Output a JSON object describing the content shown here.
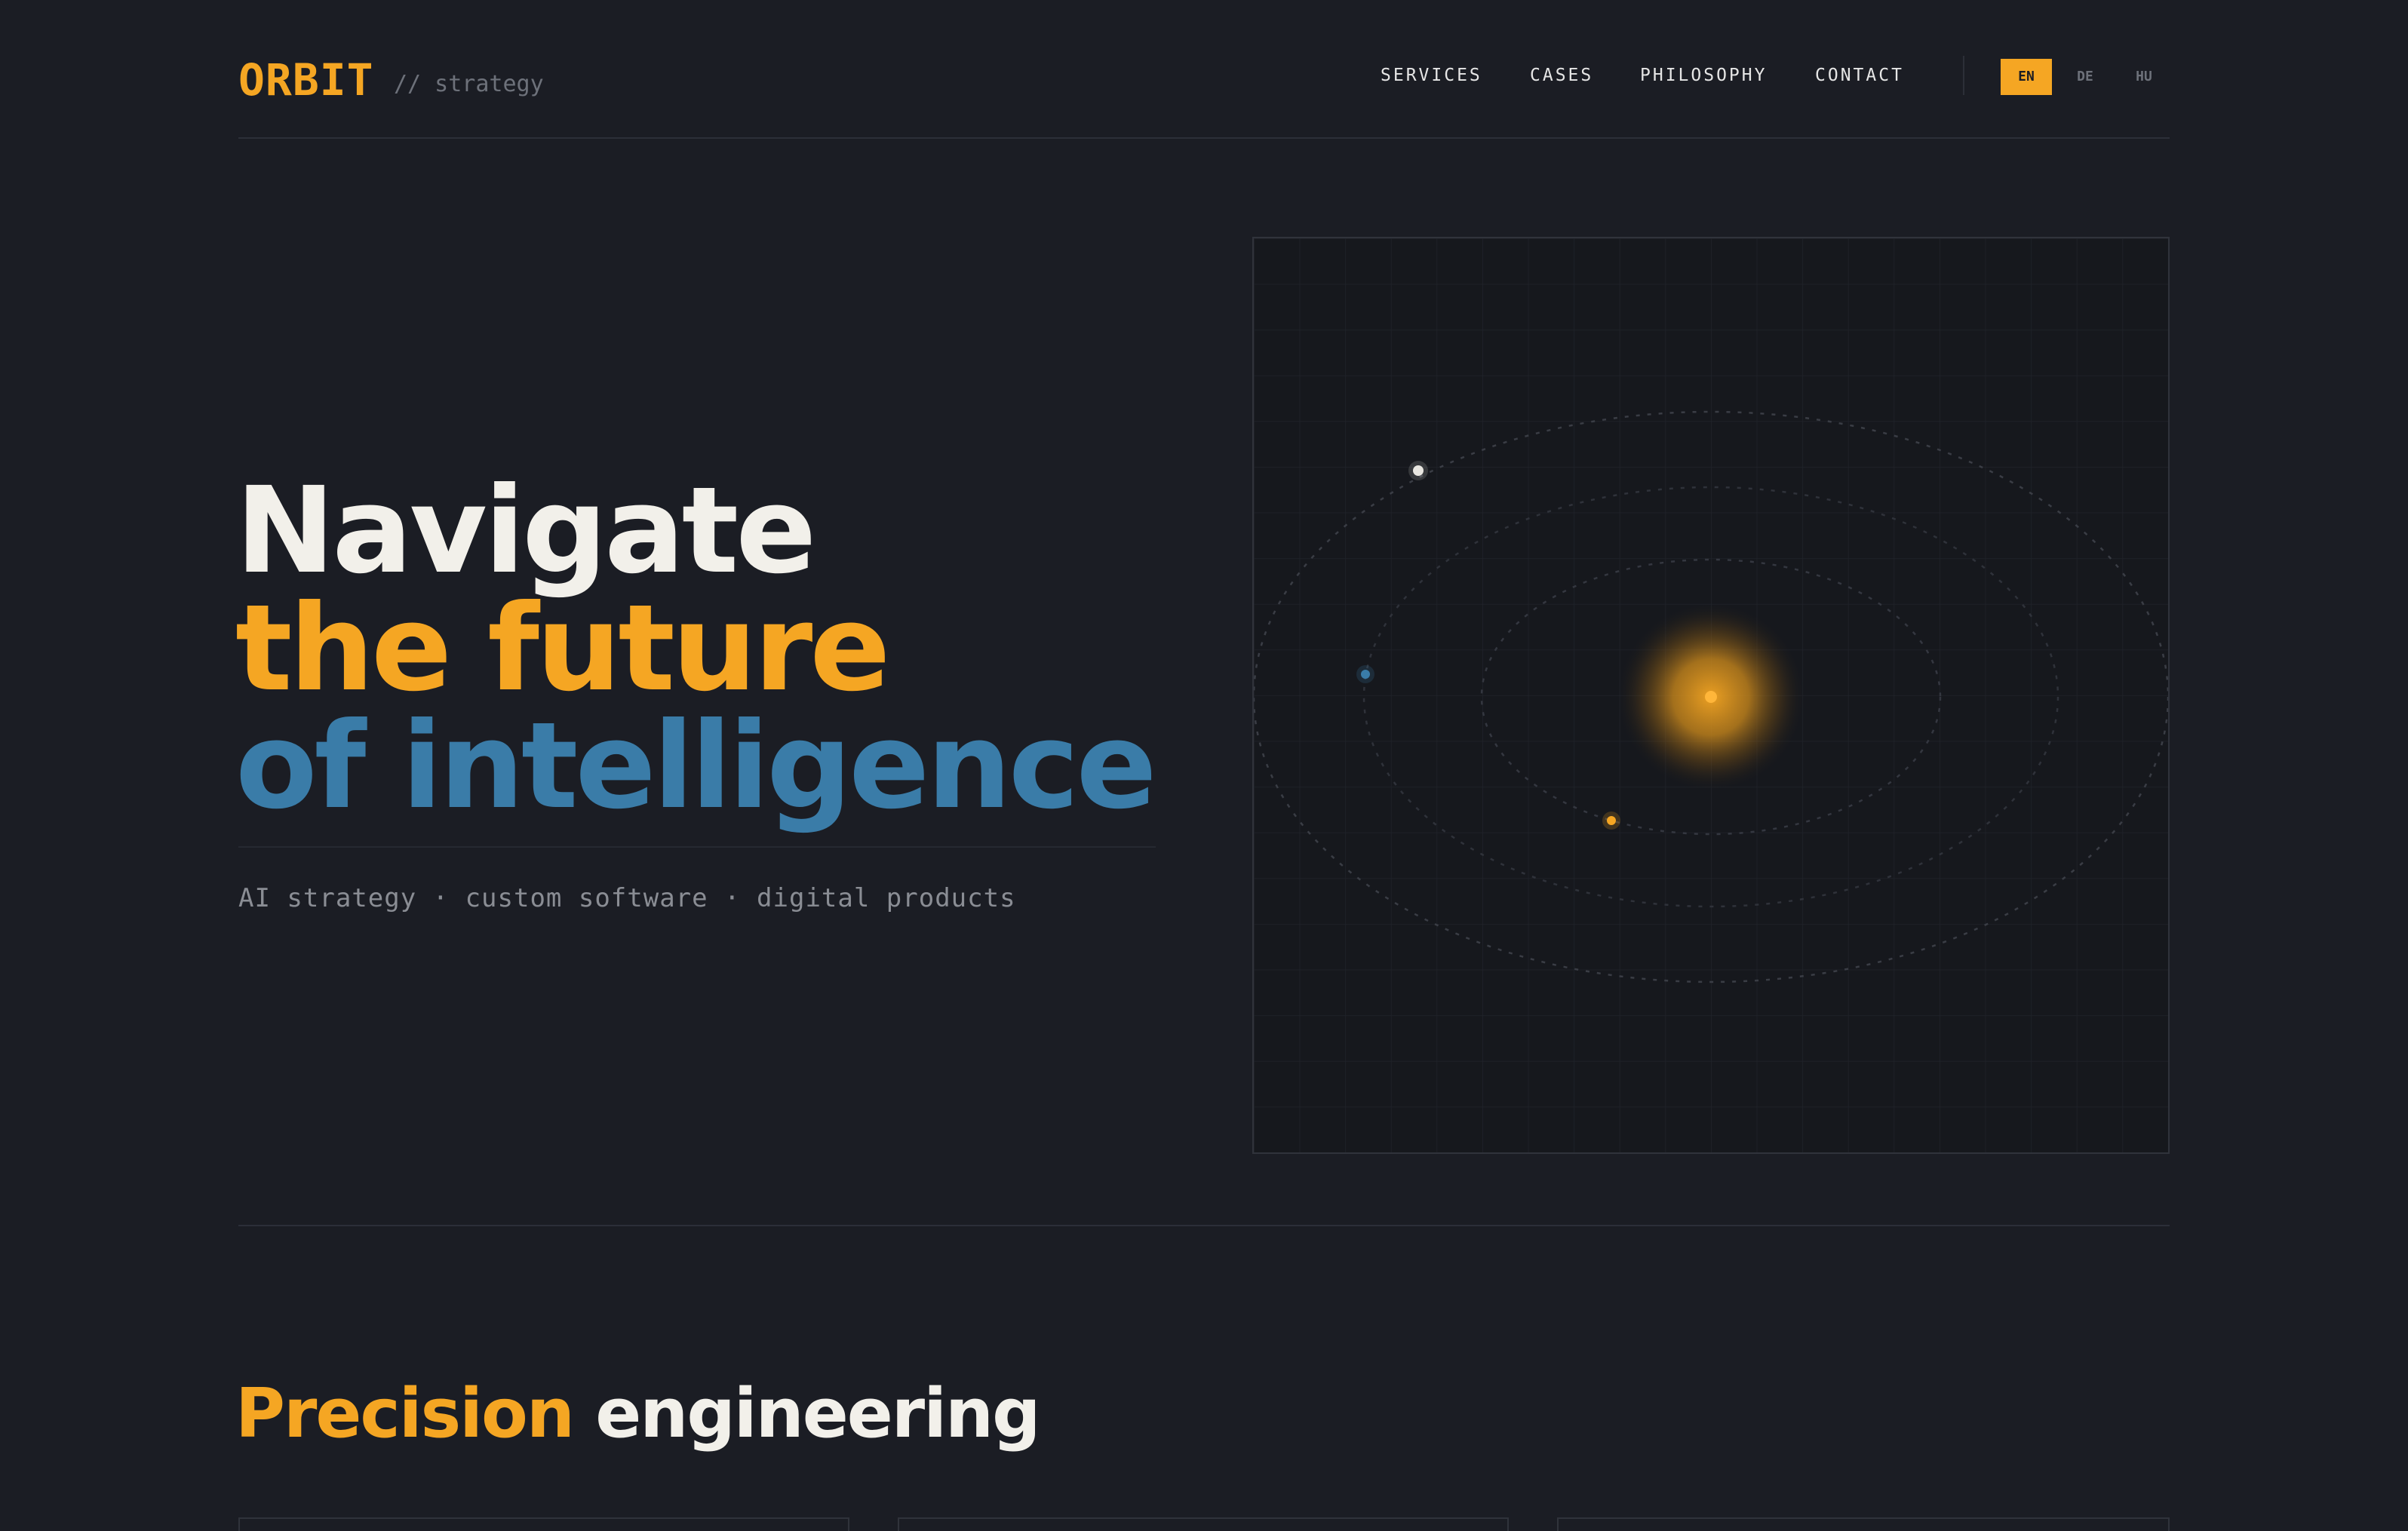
{
  "header": {
    "logo": "ORBIT",
    "logo_sub": "// strategy",
    "nav": [
      "SERVICES",
      "CASES",
      "PHILOSOPHY",
      "CONTACT"
    ],
    "languages": [
      "EN",
      "DE",
      "HU"
    ],
    "active_language": "EN"
  },
  "hero": {
    "line1": "Navigate",
    "line2": "the future",
    "line3": "of intelligence",
    "tagline": "AI strategy · custom software · digital products"
  },
  "section": {
    "title_accent": "Precision",
    "title_rest": "engineering"
  },
  "colors": {
    "background": "#1b1d24",
    "accent": "#f5a623",
    "blue": "#3a7ca8",
    "text": "#f2f0ea"
  }
}
